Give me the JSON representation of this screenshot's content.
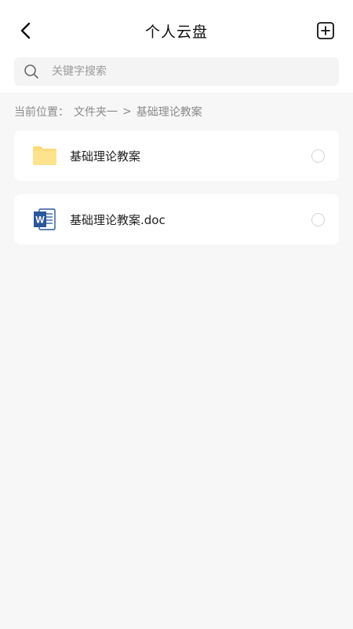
{
  "header": {
    "title": "个人云盘",
    "back_icon": "chevron-left-icon",
    "add_icon": "add-square-icon"
  },
  "search": {
    "placeholder": "关键字搜索",
    "value": "",
    "icon": "search-icon"
  },
  "breadcrumb": {
    "prefix": "当前位置：",
    "parent": "文件夹一",
    "separator": ">",
    "current": "基础理论教案"
  },
  "files": [
    {
      "type": "folder",
      "icon": "folder-icon",
      "name": "基础理论教案",
      "selected": false
    },
    {
      "type": "document",
      "icon": "word-doc-icon",
      "name": "基础理论教案.doc",
      "selected": false
    }
  ],
  "colors": {
    "background": "#f7f7f7",
    "surface": "#ffffff",
    "folder": "#fbdc7c",
    "word": "#2b579a"
  }
}
